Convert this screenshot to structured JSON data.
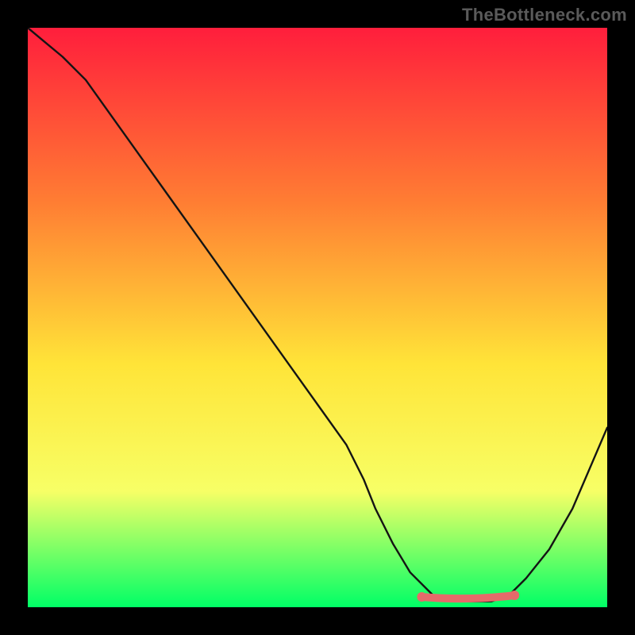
{
  "watermark": "TheBottleneck.com",
  "colors": {
    "black": "#000000",
    "gradient_top": "#ff1e3c",
    "gradient_mid1": "#ff7d33",
    "gradient_mid2": "#ffe438",
    "gradient_mid3": "#f7ff66",
    "gradient_bot": "#00ff66",
    "curve": "#141414",
    "marker": "#e66a6a"
  },
  "chart_data": {
    "type": "line",
    "title": "",
    "xlabel": "",
    "ylabel": "",
    "xlim": [
      0,
      100
    ],
    "ylim": [
      0,
      100
    ],
    "series": [
      {
        "name": "bottleneck-curve",
        "x": [
          0,
          3,
          6,
          10,
          15,
          20,
          25,
          30,
          35,
          40,
          45,
          50,
          55,
          58,
          60,
          63,
          66,
          70,
          74,
          77,
          80,
          83,
          86,
          90,
          94,
          97,
          100
        ],
        "y": [
          100,
          97.5,
          95,
          91,
          84,
          77,
          70,
          63,
          56,
          49,
          42,
          35,
          28,
          22,
          17,
          11,
          6,
          2,
          1,
          1,
          1,
          2,
          5,
          10,
          17,
          24,
          31
        ]
      }
    ],
    "optimal_band": {
      "name": "optimal-range-highlight",
      "x_start": 68,
      "x_end": 84,
      "y_approx": 1.5
    }
  }
}
